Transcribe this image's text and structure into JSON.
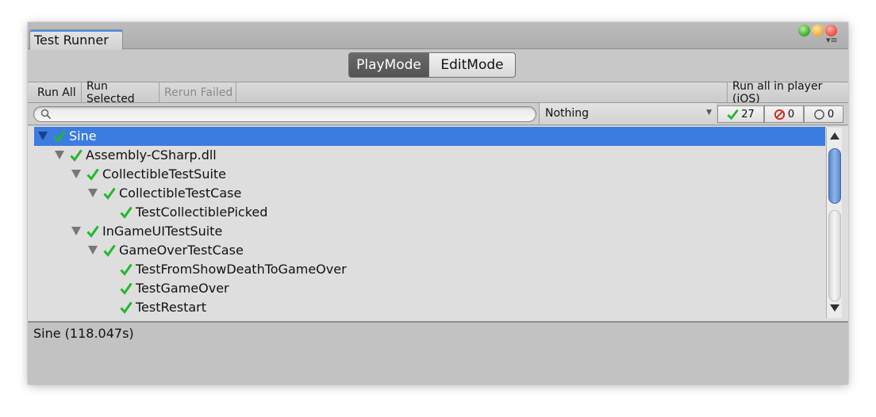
{
  "window": {
    "tab_title": "Test Runner",
    "colors": {
      "selection": "#3b7ce0",
      "pass": "#22b82a",
      "fail": "#d2231c"
    }
  },
  "mode": {
    "play_label": "PlayMode",
    "edit_label": "EditMode",
    "active": "PlayMode"
  },
  "toolbar": {
    "run_all": "Run All",
    "run_selected": "Run Selected",
    "rerun_failed": "Rerun Failed",
    "run_in_player": "Run all in player (iOS)"
  },
  "filter": {
    "search_value": "",
    "category_selected": "Nothing",
    "passed_count": "27",
    "failed_count": "0",
    "ignored_count": "0"
  },
  "tree": {
    "items": [
      {
        "label": "Sine",
        "depth": 0,
        "expanded": true,
        "selected": true,
        "status": "pass"
      },
      {
        "label": "Assembly-CSharp.dll",
        "depth": 1,
        "expanded": true,
        "status": "pass"
      },
      {
        "label": "CollectibleTestSuite",
        "depth": 2,
        "expanded": true,
        "status": "pass"
      },
      {
        "label": "CollectibleTestCase",
        "depth": 3,
        "expanded": true,
        "status": "pass"
      },
      {
        "label": "TestCollectiblePicked",
        "depth": 4,
        "leaf": true,
        "status": "pass"
      },
      {
        "label": "InGameUITestSuite",
        "depth": 2,
        "expanded": true,
        "status": "pass"
      },
      {
        "label": "GameOverTestCase",
        "depth": 3,
        "expanded": true,
        "status": "pass"
      },
      {
        "label": "TestFromShowDeathToGameOver",
        "depth": 4,
        "leaf": true,
        "status": "pass"
      },
      {
        "label": "TestGameOver",
        "depth": 4,
        "leaf": true,
        "status": "pass"
      },
      {
        "label": "TestRestart",
        "depth": 4,
        "leaf": true,
        "status": "pass"
      }
    ]
  },
  "status": {
    "text": "Sine (118.047s)"
  }
}
